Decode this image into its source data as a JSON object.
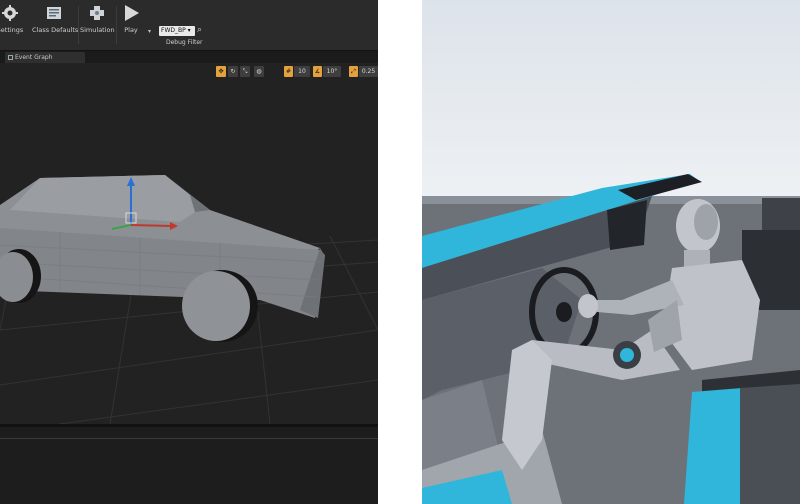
{
  "toolbar": {
    "settings_label": "Settings",
    "class_defaults_label": "Class Defaults",
    "simulation_label": "Simulation",
    "play_label": "Play",
    "debug_object": "FWD_BP ▾",
    "debug_filter_label": "Debug Filter"
  },
  "tabs": {
    "event_graph": "Event Graph"
  },
  "viewport_tools": {
    "grid_snap": "10",
    "rotation_snap": "10°",
    "scale_snap": "0.25"
  },
  "icons": {
    "settings": "gear-icon",
    "class_defaults": "class-defaults-icon",
    "simulation": "simulation-icon",
    "play": "play-icon",
    "search": "search-icon"
  },
  "colors": {
    "editor_bg": "#232323",
    "accent_orange": "#e3a23b",
    "car_body": "#8d9196",
    "cyan_trim": "#2fb6da"
  }
}
